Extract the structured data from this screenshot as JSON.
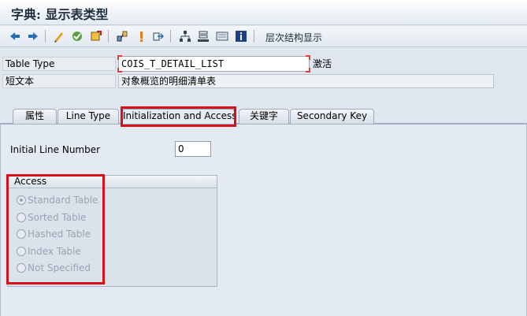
{
  "window": {
    "title": "字典: 显示表类型"
  },
  "toolbar": {
    "hierarchy_label": "层次结构显示"
  },
  "fields": {
    "table_type": {
      "label": "Table Type",
      "value": "COIS_T_DETAIL_LIST",
      "status": "激活"
    },
    "short_text": {
      "label": "短文本",
      "value": "对象概览的明细清单表"
    }
  },
  "tabs": [
    {
      "label": "属性"
    },
    {
      "label": "Line Type"
    },
    {
      "label": "Initialization and Access"
    },
    {
      "label": "关键字"
    },
    {
      "label": "Secondary Key"
    }
  ],
  "active_tab": "Initialization and Access",
  "init": {
    "label": "Initial Line Number",
    "value": "0"
  },
  "access": {
    "title": "Access",
    "options": [
      {
        "label": "Standard Table",
        "checked": true
      },
      {
        "label": "Sorted Table",
        "checked": false
      },
      {
        "label": "Hashed Table",
        "checked": false
      },
      {
        "label": "Index Table",
        "checked": false
      },
      {
        "label": "Not Specified",
        "checked": false
      }
    ]
  },
  "colors": {
    "highlight": "#d8101a",
    "background": "#dfe6ee"
  }
}
